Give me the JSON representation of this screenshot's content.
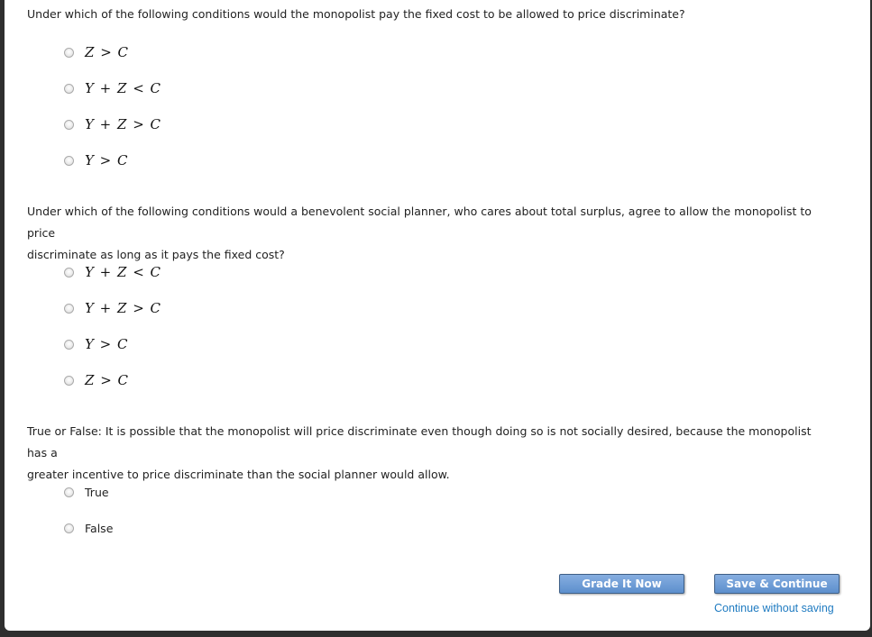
{
  "questions": [
    {
      "prompt": "Under which of the following conditions would the monopolist pay the fixed cost to be allowed to price discriminate?",
      "options": [
        "Z > C",
        "Y + Z < C",
        "Y + Z > C",
        "Y > C"
      ]
    },
    {
      "prompt_line1": "Under which of the following conditions would a benevolent social planner, who cares about total surplus, agree to allow the monopolist to price",
      "prompt_line2": "discriminate as long as it pays the fixed cost?",
      "options": [
        "Y + Z < C",
        "Y + Z > C",
        "Y > C",
        "Z > C"
      ]
    },
    {
      "prompt_line1": "True or False: It is possible that the monopolist will price discriminate even though doing so is not socially desired, because the monopolist has a",
      "prompt_line2": "greater incentive to price discriminate than the social planner would allow.",
      "options": [
        "True",
        "False"
      ]
    }
  ],
  "actions": {
    "grade_label": "Grade It Now",
    "save_label": "Save & Continue",
    "continue_link": "Continue without saving"
  }
}
